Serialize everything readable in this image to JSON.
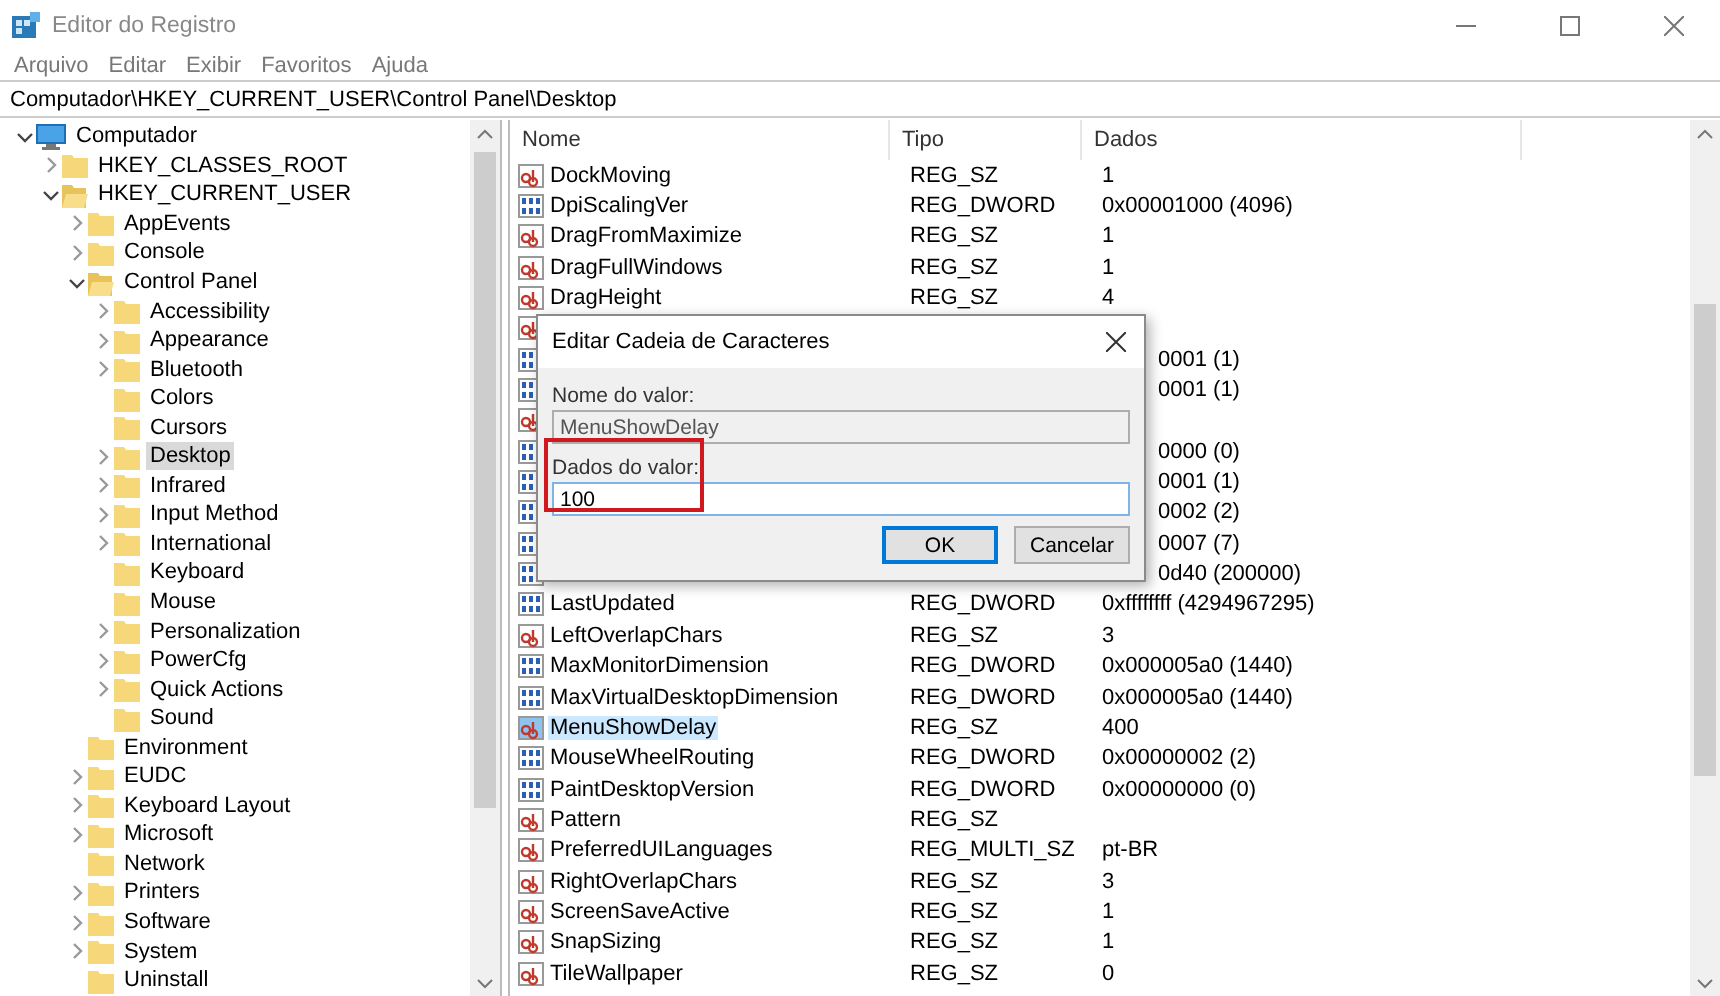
{
  "window": {
    "title": "Editor do Registro"
  },
  "menu": [
    "Arquivo",
    "Editar",
    "Exibir",
    "Favoritos",
    "Ajuda"
  ],
  "address": "Computador\\HKEY_CURRENT_USER\\Control Panel\\Desktop",
  "tree": [
    {
      "label": "Computador",
      "kind": "computer",
      "expandable": true,
      "expanded": true,
      "selected": false,
      "children": [
        {
          "label": "HKEY_CLASSES_ROOT",
          "kind": "folder",
          "expandable": true,
          "expanded": false,
          "selected": false
        },
        {
          "label": "HKEY_CURRENT_USER",
          "kind": "folder",
          "expandable": true,
          "expanded": true,
          "selected": false,
          "children": [
            {
              "label": "AppEvents",
              "kind": "folder",
              "expandable": true,
              "expanded": false,
              "selected": false
            },
            {
              "label": "Console",
              "kind": "folder",
              "expandable": true,
              "expanded": false,
              "selected": false
            },
            {
              "label": "Control Panel",
              "kind": "folder",
              "expandable": true,
              "expanded": true,
              "selected": false,
              "children": [
                {
                  "label": "Accessibility",
                  "kind": "folder",
                  "expandable": true,
                  "expanded": false,
                  "selected": false
                },
                {
                  "label": "Appearance",
                  "kind": "folder",
                  "expandable": true,
                  "expanded": false,
                  "selected": false
                },
                {
                  "label": "Bluetooth",
                  "kind": "folder",
                  "expandable": true,
                  "expanded": false,
                  "selected": false
                },
                {
                  "label": "Colors",
                  "kind": "folder",
                  "expandable": false,
                  "expanded": false,
                  "selected": false
                },
                {
                  "label": "Cursors",
                  "kind": "folder",
                  "expandable": false,
                  "expanded": false,
                  "selected": false
                },
                {
                  "label": "Desktop",
                  "kind": "folder",
                  "expandable": true,
                  "expanded": false,
                  "selected": true
                },
                {
                  "label": "Infrared",
                  "kind": "folder",
                  "expandable": true,
                  "expanded": false,
                  "selected": false
                },
                {
                  "label": "Input Method",
                  "kind": "folder",
                  "expandable": true,
                  "expanded": false,
                  "selected": false
                },
                {
                  "label": "International",
                  "kind": "folder",
                  "expandable": true,
                  "expanded": false,
                  "selected": false
                },
                {
                  "label": "Keyboard",
                  "kind": "folder",
                  "expandable": false,
                  "expanded": false,
                  "selected": false
                },
                {
                  "label": "Mouse",
                  "kind": "folder",
                  "expandable": false,
                  "expanded": false,
                  "selected": false
                },
                {
                  "label": "Personalization",
                  "kind": "folder",
                  "expandable": true,
                  "expanded": false,
                  "selected": false
                },
                {
                  "label": "PowerCfg",
                  "kind": "folder",
                  "expandable": true,
                  "expanded": false,
                  "selected": false
                },
                {
                  "label": "Quick Actions",
                  "kind": "folder",
                  "expandable": true,
                  "expanded": false,
                  "selected": false
                },
                {
                  "label": "Sound",
                  "kind": "folder",
                  "expandable": false,
                  "expanded": false,
                  "selected": false
                }
              ]
            },
            {
              "label": "Environment",
              "kind": "folder",
              "expandable": false,
              "expanded": false,
              "selected": false
            },
            {
              "label": "EUDC",
              "kind": "folder",
              "expandable": true,
              "expanded": false,
              "selected": false
            },
            {
              "label": "Keyboard Layout",
              "kind": "folder",
              "expandable": true,
              "expanded": false,
              "selected": false
            },
            {
              "label": "Microsoft",
              "kind": "folder",
              "expandable": true,
              "expanded": false,
              "selected": false
            },
            {
              "label": "Network",
              "kind": "folder",
              "expandable": false,
              "expanded": false,
              "selected": false
            },
            {
              "label": "Printers",
              "kind": "folder",
              "expandable": true,
              "expanded": false,
              "selected": false
            },
            {
              "label": "Software",
              "kind": "folder",
              "expandable": true,
              "expanded": false,
              "selected": false
            },
            {
              "label": "System",
              "kind": "folder",
              "expandable": true,
              "expanded": false,
              "selected": false
            },
            {
              "label": "Uninstall",
              "kind": "folder",
              "expandable": false,
              "expanded": false,
              "selected": false
            }
          ]
        }
      ]
    }
  ],
  "table": {
    "columns": [
      "Nome",
      "Tipo",
      "Dados"
    ],
    "rows": [
      {
        "kind": "string",
        "name": "DockMoving",
        "type": "REG_SZ",
        "data": "1",
        "selected": false
      },
      {
        "kind": "binary",
        "name": "DpiScalingVer",
        "type": "REG_DWORD",
        "data": "0x00001000 (4096)",
        "selected": false
      },
      {
        "kind": "string",
        "name": "DragFromMaximize",
        "type": "REG_SZ",
        "data": "1",
        "selected": false
      },
      {
        "kind": "string",
        "name": "DragFullWindows",
        "type": "REG_SZ",
        "data": "1",
        "selected": false
      },
      {
        "kind": "string",
        "name": "DragHeight",
        "type": "REG_SZ",
        "data": "4",
        "selected": false
      },
      {
        "kind": "string",
        "selected": false
      },
      {
        "kind": "binary",
        "data": "0001 (1)",
        "selected": false
      },
      {
        "kind": "binary",
        "data": "0001 (1)",
        "selected": false
      },
      {
        "kind": "string",
        "selected": false
      },
      {
        "kind": "binary",
        "data": "0000 (0)",
        "selected": false
      },
      {
        "kind": "binary",
        "data": "0001 (1)",
        "selected": false
      },
      {
        "kind": "binary",
        "data": "0002 (2)",
        "selected": false
      },
      {
        "kind": "binary",
        "data": "0007 (7)",
        "selected": false
      },
      {
        "kind": "binary",
        "data": "0d40 (200000)",
        "selected": false
      },
      {
        "kind": "binary",
        "name": "LastUpdated",
        "type": "REG_DWORD",
        "data": "0xffffffff (4294967295)",
        "selected": false
      },
      {
        "kind": "string",
        "name": "LeftOverlapChars",
        "type": "REG_SZ",
        "data": "3",
        "selected": false
      },
      {
        "kind": "binary",
        "name": "MaxMonitorDimension",
        "type": "REG_DWORD",
        "data": "0x000005a0 (1440)",
        "selected": false
      },
      {
        "kind": "binary",
        "name": "MaxVirtualDesktopDimension",
        "type": "REG_DWORD",
        "data": "0x000005a0 (1440)",
        "selected": false
      },
      {
        "kind": "string",
        "name": "MenuShowDelay",
        "type": "REG_SZ",
        "data": "400",
        "selected": true
      },
      {
        "kind": "binary",
        "name": "MouseWheelRouting",
        "type": "REG_DWORD",
        "data": "0x00000002 (2)",
        "selected": false
      },
      {
        "kind": "binary",
        "name": "PaintDesktopVersion",
        "type": "REG_DWORD",
        "data": "0x00000000 (0)",
        "selected": false
      },
      {
        "kind": "string",
        "name": "Pattern",
        "type": "REG_SZ",
        "selected": false
      },
      {
        "kind": "string",
        "name": "PreferredUILanguages",
        "type": "REG_MULTI_SZ",
        "data": "pt-BR",
        "selected": false
      },
      {
        "kind": "string",
        "name": "RightOverlapChars",
        "type": "REG_SZ",
        "data": "3",
        "selected": false
      },
      {
        "kind": "string",
        "name": "ScreenSaveActive",
        "type": "REG_SZ",
        "data": "1",
        "selected": false
      },
      {
        "kind": "string",
        "name": "SnapSizing",
        "type": "REG_SZ",
        "data": "1",
        "selected": false
      },
      {
        "kind": "string",
        "name": "TileWallpaper",
        "type": "REG_SZ",
        "data": "0",
        "selected": false
      }
    ]
  },
  "dialog": {
    "title": "Editar Cadeia de Caracteres",
    "name_label": "Nome do valor:",
    "name_value": "MenuShowDelay",
    "data_label": "Dados do valor:",
    "data_value": "100",
    "buttons": [
      {
        "label": "OK",
        "selected": true
      },
      {
        "label": "Cancelar",
        "selected": false
      }
    ]
  }
}
